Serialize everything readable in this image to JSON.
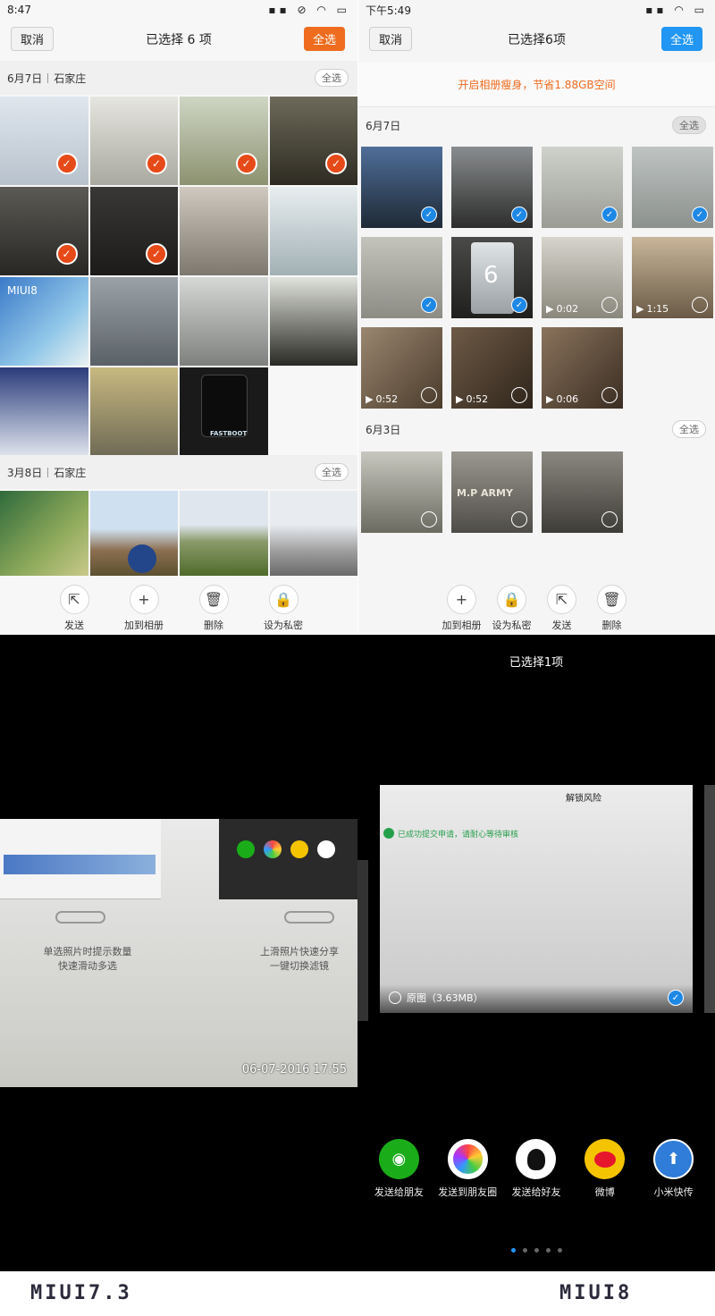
{
  "left_top": {
    "status_time": "8:47",
    "cancel_label": "取消",
    "title": "已选择 6 项",
    "select_all_label": "全选",
    "accent": "#ef6c1f",
    "sections": [
      {
        "date": "6月7日",
        "place": "石家庄",
        "select_all": "全选",
        "mosaic_label": "MIUI8",
        "fastboot_label": "FASTBOOT",
        "photo_stamp": "06-07-2016"
      },
      {
        "date": "3月8日",
        "place": "石家庄",
        "select_all": "全选"
      }
    ],
    "actions": [
      {
        "icon": "send-icon",
        "label": "发送"
      },
      {
        "icon": "plus-icon",
        "label": "加到相册"
      },
      {
        "icon": "trash-icon",
        "label": "删除"
      },
      {
        "icon": "lock-icon",
        "label": "设为私密"
      }
    ]
  },
  "right_top": {
    "status_time": "下午5:49",
    "cancel_label": "取消",
    "title": "已选择6项",
    "select_all_label": "全选",
    "accent": "#2196f3",
    "banner": "开启相册瘦身，节省1.88GB空间",
    "banner_color": "#ef6c1f",
    "sections": [
      {
        "date": "6月7日",
        "select_all": "全选",
        "big_number": "6",
        "durations": [
          "0:02",
          "1:15",
          "0:52",
          "0:52",
          "0:06"
        ]
      },
      {
        "date": "6月3日",
        "select_all": "全选",
        "sign_text": "M.P ARMY"
      }
    ],
    "actions": [
      {
        "icon": "plus-icon",
        "label": "加到相册"
      },
      {
        "icon": "lock-icon",
        "label": "设为私密"
      },
      {
        "icon": "send-icon",
        "label": "发送"
      },
      {
        "icon": "trash-icon",
        "label": "删除"
      }
    ]
  },
  "left_bottom": {
    "screen_left_text_1": "单选照片时提示数量",
    "screen_left_text_2": "快速滑动多选",
    "screen_right_text_1": "上滑照片快速分享",
    "screen_right_text_2": "一键切换滤镜",
    "timestamp": "06-07-2016 17:55"
  },
  "right_bottom": {
    "title": "已选择1项",
    "doc_heading": "解锁风险",
    "submit_text": "已成功提交申请，请耐心等待审核",
    "original_label": "原图（3.63MB）",
    "share_targets": [
      {
        "icon": "wechat-icon",
        "label": "发送给朋友",
        "color": "#1aad19"
      },
      {
        "icon": "moments-icon",
        "label": "发送到朋友圈",
        "color": "#ffffff"
      },
      {
        "icon": "qq-icon",
        "label": "发送给好友",
        "color": "#ffffff"
      },
      {
        "icon": "weibo-icon",
        "label": "微博",
        "color": "#f5c400"
      },
      {
        "icon": "mi-drop-icon",
        "label": "小米快传",
        "color": "#2f7cd9"
      }
    ]
  },
  "footer": {
    "left_logo": "MIUI7.3",
    "right_logo": "MIUI8"
  }
}
